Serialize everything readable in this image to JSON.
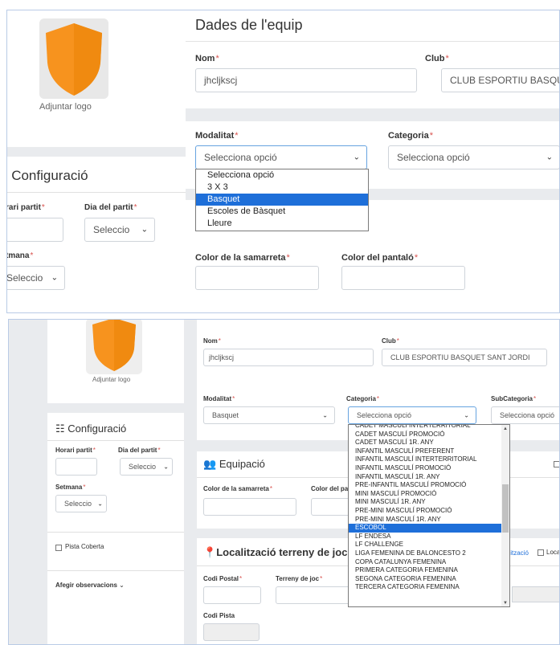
{
  "top": {
    "logo_label": "Adjuntar logo",
    "section_title": "Dades de l'equip",
    "nom_label": "Nom",
    "nom_value": "jhcljkscj",
    "club_label": "Club",
    "club_value": "CLUB ESPORTIU BASQU",
    "modalitat_label": "Modalitat",
    "modalitat_value": "Selecciona opció",
    "categoria_label": "Categoria",
    "categoria_value": "Selecciona opció",
    "modalitat_options": [
      "Selecciona opció",
      "3 X 3",
      "Basquet",
      "Escoles de Bàsquet",
      "Lleure"
    ],
    "config_title": "Configuració",
    "horari_label": "rari partit",
    "dia_label": "Dia del partit",
    "dia_value": "Seleccio",
    "setmana_label": "tmana",
    "setmana_value": "Seleccio",
    "samarreta_label": "Color de la samarreta",
    "pantalo_label": "Color del pantaló",
    "required_mark": "*"
  },
  "bottom": {
    "logo_label": "Adjuntar logo",
    "nom_label": "Nom",
    "nom_value": "jhcljkscj",
    "club_label": "Club",
    "club_value": "CLUB ESPORTIU BASQUET SANT JORDI",
    "modalitat_label": "Modalitat",
    "modalitat_value": "Basquet",
    "categoria_label": "Categoria",
    "categoria_value": "Selecciona opció",
    "subcategoria_label": "SubCategoria",
    "subcategoria_value": "Selecciona opció",
    "config_title": "Configuració",
    "horari_label": "Horari partit",
    "dia_label": "Dia del partit",
    "dia_value": "Seleccio",
    "setmana_label": "Setmana",
    "setmana_value": "Seleccio",
    "pista_coberta_label": "Pista Coberta",
    "observacions_label": "Afegir observacions",
    "equipacio_title": "Equipació",
    "samarreta_label": "Color de la samarreta",
    "pantalo_label": "Color del pa",
    "localitzacio_title": "Localització terreny de joc",
    "localitzacio_link": "alització",
    "loca_label": "Loca",
    "codi_postal_label": "Codi Postal",
    "terreny_label": "Terreny de joc",
    "codi_pista_label": "Codi Pista",
    "categoria_options": [
      "CADET MASCULÍ INTERTERRITORIAL",
      "CADET MASCULÍ PROMOCIÓ",
      "CADET MASCULÍ 1R. ANY",
      "INFANTIL MASCULÍ PREFERENT",
      "INFANTIL MASCULÍ INTERTERRITORIAL",
      "INFANTIL MASCULÍ PROMOCIÓ",
      "INFANTIL MASCULÍ 1R. ANY",
      "PRE-INFANTIL MASCULÍ PROMOCIÓ",
      "MINI MASCULÍ PROMOCIÓ",
      "MINI MASCULÍ 1R. ANY",
      "PRE-MINI MASCULÍ PROMOCIÓ",
      "PRE-MINI MASCULÍ 1R. ANY",
      "ESCOBOL",
      "LF ENDESA",
      "LF CHALLENGE",
      "LIGA FEMENINA DE BALONCESTO 2",
      "COPA CATALUNYA FEMENINA",
      "PRIMERA CATEGORIA FEMENINA",
      "SEGONA CATEGORIA FEMENINA",
      "TERCERA CATEGORIA FEMENINA"
    ],
    "categoria_selected": "ESCOBOL",
    "required_mark": "*"
  },
  "colors": {
    "accent": "#f7931e",
    "selected": "#1e6fd9",
    "required": "#d9534f"
  }
}
